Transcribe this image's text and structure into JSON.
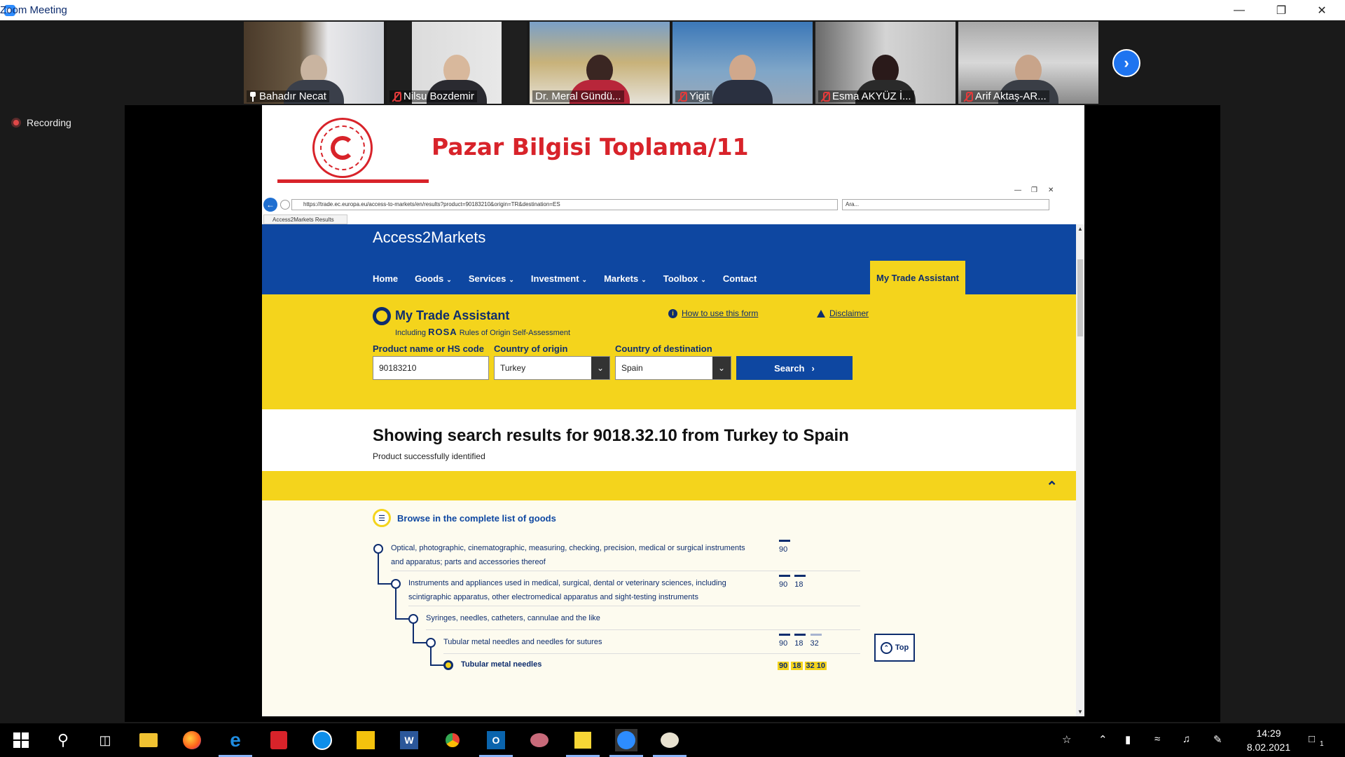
{
  "window": {
    "title": "Zoom Meeting"
  },
  "participants": [
    {
      "name": "Bahadır Necat",
      "muted": false,
      "active": true
    },
    {
      "name": "Nilsu Bozdemir",
      "muted": true,
      "active": false
    },
    {
      "name": "Dr. Meral Gündü...",
      "muted": false,
      "active": false
    },
    {
      "name": "Yigit",
      "muted": true,
      "active": false
    },
    {
      "name": "Esma AKYÜZ İ...",
      "muted": true,
      "active": false
    },
    {
      "name": "Arif Aktaş-AR...",
      "muted": true,
      "active": false
    }
  ],
  "recording": {
    "label": "Recording"
  },
  "slide": {
    "title": "Pazar Bilgisi Toplama/11"
  },
  "browser": {
    "url": "https://trade.ec.europa.eu/access-to-markets/en/results?product=90183210&origin=TR&destination=ES",
    "search_placeholder": "Ara...",
    "tab_label": "Access2Markets Results"
  },
  "site": {
    "brand": "Access2Markets",
    "nav": [
      {
        "label": "Home",
        "dropdown": false
      },
      {
        "label": "Goods",
        "dropdown": true
      },
      {
        "label": "Services",
        "dropdown": true
      },
      {
        "label": "Investment",
        "dropdown": true
      },
      {
        "label": "Markets",
        "dropdown": true
      },
      {
        "label": "Toolbox",
        "dropdown": true
      },
      {
        "label": "Contact",
        "dropdown": false
      }
    ],
    "mta_button": "My Trade Assistant"
  },
  "form": {
    "title": "My Trade Assistant",
    "sub_pre": "Including",
    "sub_rosa": "ROSA",
    "sub_post": "Rules of Origin Self-Assessment",
    "how_to": "How to use this form",
    "disclaimer": "Disclaimer",
    "product_label": "Product name or HS code",
    "product_value": "90183210",
    "origin_label": "Country of origin",
    "origin_value": "Turkey",
    "destination_label": "Country of destination",
    "destination_value": "Spain",
    "search_label": "Search"
  },
  "results": {
    "title": "Showing search results for 9018.32.10 from Turkey to Spain",
    "subtitle": "Product successfully identified",
    "browse_label": "Browse in the complete list of goods",
    "tree": [
      {
        "text": "Optical, photographic, cinematographic, measuring, checking, precision, medical or surgical instruments and apparatus; parts and accessories thereof",
        "codes": [
          "90"
        ]
      },
      {
        "text": "Instruments and appliances used in medical, surgical, dental or veterinary sciences, including scintigraphic apparatus, other electromedical apparatus and sight-testing instruments",
        "codes": [
          "90",
          "18"
        ]
      },
      {
        "text": "Syringes, needles, catheters, cannulae and the like",
        "codes": []
      },
      {
        "text": "Tubular metal needles and needles for sutures",
        "codes": [
          "90",
          "18",
          "32"
        ]
      },
      {
        "text": "Tubular metal needles",
        "codes": [
          "90",
          "18",
          "32 10"
        ]
      }
    ],
    "top_label": "Top"
  },
  "taskbar": {
    "time": "14:29",
    "date": "8.02.2021",
    "notification_count": "1"
  }
}
